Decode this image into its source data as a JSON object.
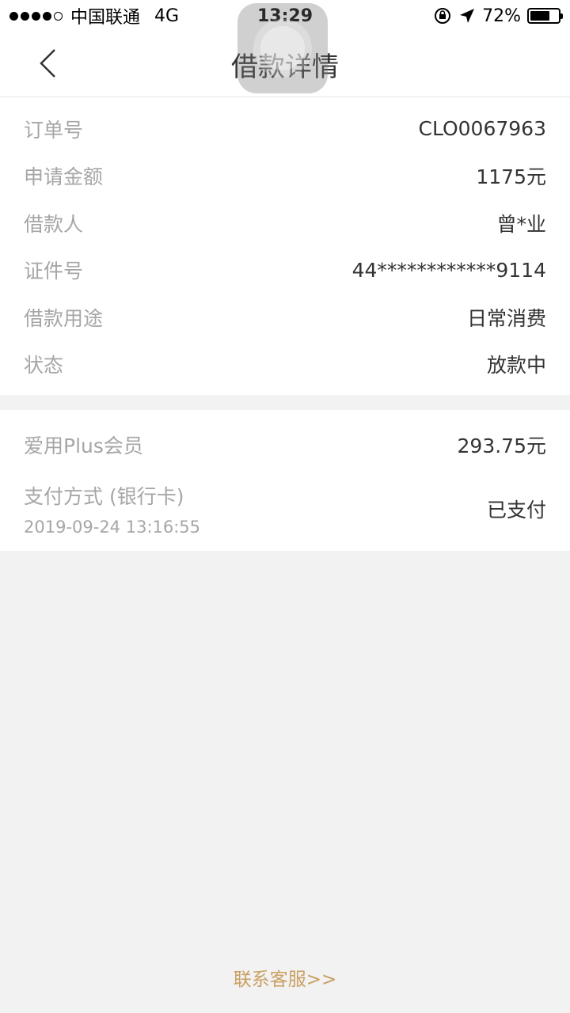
{
  "status_bar": {
    "carrier": "中国联通",
    "network": "4G",
    "time": "13:29",
    "battery_text": "72%",
    "battery_level": 0.72
  },
  "nav": {
    "title": "借款详情",
    "back_icon": "chevron-left-icon"
  },
  "details": [
    {
      "label": "订单号",
      "value": "CLO0067963"
    },
    {
      "label": "申请金额",
      "value": "1175元"
    },
    {
      "label": "借款人",
      "value": "曾*业"
    },
    {
      "label": "证件号",
      "value": "44************9114"
    },
    {
      "label": "借款用途",
      "value": "日常消费"
    },
    {
      "label": "状态",
      "value": "放款中"
    }
  ],
  "membership": {
    "label": "爱用Plus会员",
    "value": "293.75元",
    "payment_label": "支付方式 (银行卡)",
    "payment_date": "2019-09-24 13:16:55",
    "payment_status": "已支付"
  },
  "footer": {
    "contact_link": "联系客服>>"
  },
  "colors": {
    "accent": "#c9a063",
    "label": "#a6a6a6",
    "value": "#333333",
    "background": "#f2f2f2"
  }
}
